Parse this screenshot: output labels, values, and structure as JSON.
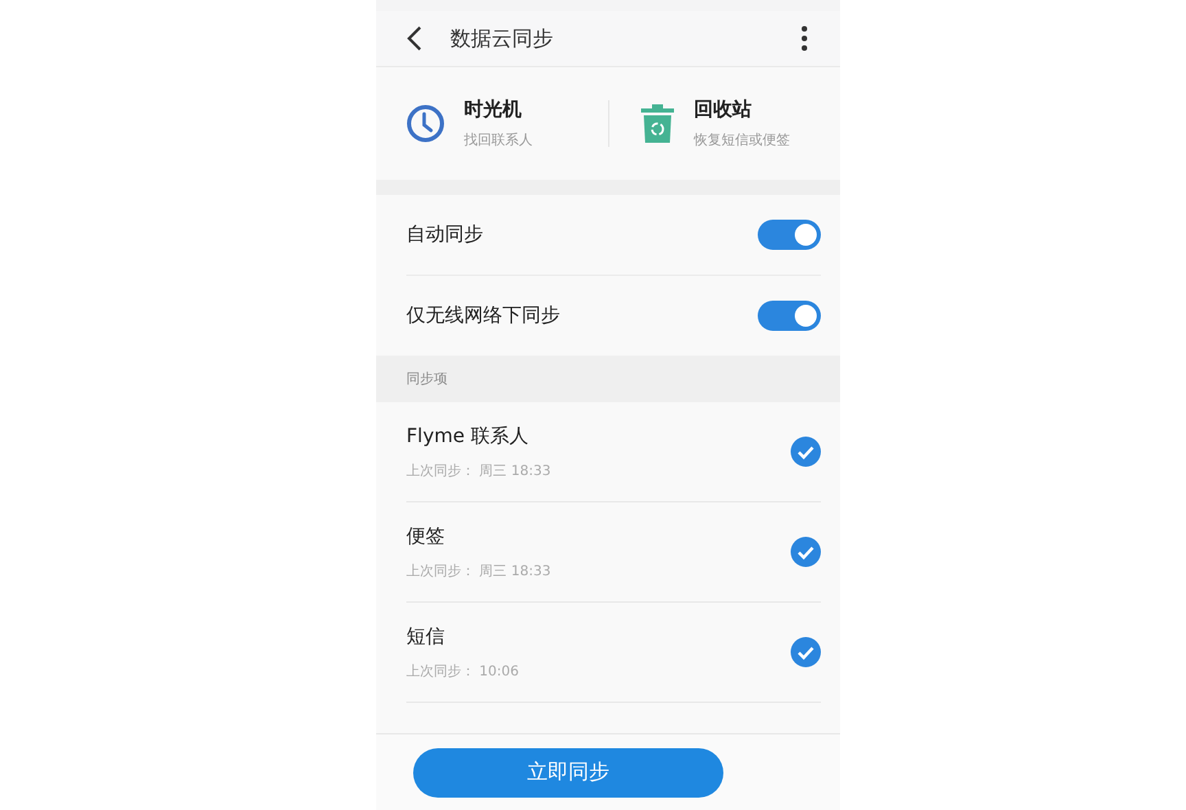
{
  "header": {
    "title": "数据云同步"
  },
  "shortcuts": [
    {
      "kind": "clock",
      "title": "时光机",
      "subtitle": "找回联系人"
    },
    {
      "kind": "trash",
      "title": "回收站",
      "subtitle": "恢复短信或便签"
    }
  ],
  "settings": [
    {
      "label": "自动同步",
      "on": true
    },
    {
      "label": "仅无线网络下同步",
      "on": true
    }
  ],
  "section": {
    "title": "同步项"
  },
  "items": [
    {
      "name": "Flyme 联系人",
      "last_sync": "上次同步： 周三 18:33",
      "checked": true
    },
    {
      "name": "便签",
      "last_sync": "上次同步： 周三 18:33",
      "checked": true
    },
    {
      "name": "短信",
      "last_sync": "上次同步： 10:06",
      "checked": true
    }
  ],
  "button": {
    "label": "立即同步"
  }
}
